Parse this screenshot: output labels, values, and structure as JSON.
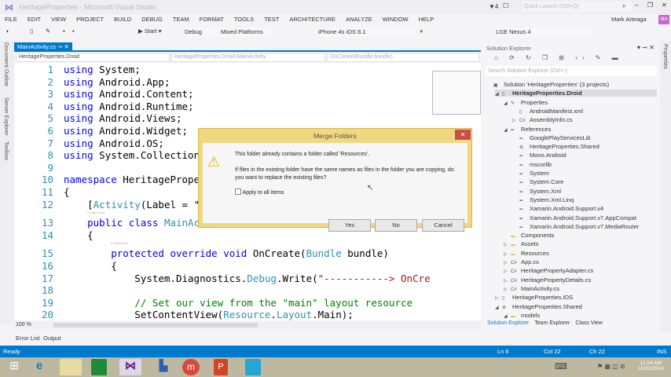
{
  "window": {
    "title": "HeritageProperties - Microsoft Visual Studio",
    "notification_count": "4",
    "quick_launch_placeholder": "Quick Launch (Ctrl+Q)",
    "user": "Mark Arteaga",
    "user_initials": "MA"
  },
  "menu": [
    "FILE",
    "EDIT",
    "VIEW",
    "PROJECT",
    "BUILD",
    "DEBUG",
    "TEAM",
    "FORMAT",
    "TOOLS",
    "TEST",
    "ARCHITECTURE",
    "ANALYZE",
    "WINDOW",
    "HELP"
  ],
  "toolbar": {
    "start": "Start",
    "config": "Debug",
    "platform": "Mixed Platforms",
    "ios_device": "iPhone 4s iOS 8.1",
    "android_device": "LGE Nexus 4"
  },
  "side_tabs": [
    "Document Outline",
    "Server Explorer",
    "Toolbox"
  ],
  "editor": {
    "tab": "MainActivity.cs",
    "nav": [
      "HeritageProperties.Droid",
      "HeritageProperties.Droid.MainActivity",
      "OnCreate(Bundle bundle)"
    ],
    "zoom": "100 %",
    "lines": [
      {
        "n": "1",
        "tokens": [
          {
            "c": "kw",
            "t": "using"
          },
          {
            "t": " System;"
          }
        ]
      },
      {
        "n": "2",
        "tokens": [
          {
            "c": "kw",
            "t": "using"
          },
          {
            "t": " Android.App;"
          }
        ]
      },
      {
        "n": "3",
        "tokens": [
          {
            "c": "kw",
            "t": "using"
          },
          {
            "t": " Android.Content;"
          }
        ]
      },
      {
        "n": "4",
        "tokens": [
          {
            "c": "kw",
            "t": "using"
          },
          {
            "t": " Android.Runtime;"
          }
        ]
      },
      {
        "n": "5",
        "tokens": [
          {
            "c": "kw",
            "t": "using"
          },
          {
            "t": " Android.Views;"
          }
        ]
      },
      {
        "n": "6",
        "tokens": [
          {
            "c": "kw",
            "t": "using"
          },
          {
            "t": " Android.Widget;"
          }
        ]
      },
      {
        "n": "7",
        "tokens": [
          {
            "c": "kw",
            "t": "using"
          },
          {
            "t": " Android.OS;"
          }
        ]
      },
      {
        "n": "8",
        "tokens": [
          {
            "c": "kw",
            "t": "using"
          },
          {
            "t": " System.Collection"
          }
        ]
      },
      {
        "n": "9",
        "tokens": []
      },
      {
        "n": "10",
        "tokens": [
          {
            "c": "kw",
            "t": "namespace"
          },
          {
            "t": " HeritagePrope"
          }
        ]
      },
      {
        "n": "11",
        "tokens": [
          {
            "t": "{"
          }
        ]
      },
      {
        "n": "12",
        "tokens": [
          {
            "t": "    ["
          },
          {
            "c": "ty",
            "t": "Activity"
          },
          {
            "t": "(Label = \""
          }
        ]
      },
      {
        "n": "13",
        "lens": "2 references",
        "tokens": [
          {
            "t": "    "
          },
          {
            "c": "kw",
            "t": "public class"
          },
          {
            "t": " "
          },
          {
            "c": "ty",
            "t": "MainAc"
          }
        ]
      },
      {
        "n": "14",
        "tokens": [
          {
            "t": "    {"
          }
        ]
      },
      {
        "n": "15",
        "lens": "3 references",
        "tokens": [
          {
            "t": "        "
          },
          {
            "c": "kw",
            "t": "protected override void"
          },
          {
            "t": " OnCreate("
          },
          {
            "c": "ty",
            "t": "Bundle"
          },
          {
            "t": " bundle)"
          }
        ]
      },
      {
        "n": "16",
        "tokens": [
          {
            "t": "        {"
          }
        ]
      },
      {
        "n": "17",
        "tokens": [
          {
            "t": "            System.Diagnostics."
          },
          {
            "c": "ty",
            "t": "Debug"
          },
          {
            "t": ".Write("
          },
          {
            "c": "st",
            "t": "\"-----------> OnCre"
          }
        ]
      },
      {
        "n": "18",
        "tokens": []
      },
      {
        "n": "19",
        "tokens": [
          {
            "t": "            "
          },
          {
            "c": "cm",
            "t": "// Set our view from the \"main\" layout resource"
          }
        ]
      },
      {
        "n": "20",
        "tokens": [
          {
            "t": "            SetContentView("
          },
          {
            "c": "ty",
            "t": "Resource"
          },
          {
            "t": "."
          },
          {
            "c": "ty",
            "t": "Layout"
          },
          {
            "t": ".Main);"
          }
        ]
      }
    ]
  },
  "bottom_tabs": [
    "Error List",
    "Output"
  ],
  "status": {
    "text": "Ready",
    "ln": "Ln 6",
    "col": "Col 22",
    "ch": "Ch 22",
    "mode": "INS"
  },
  "clock": {
    "time": "11:54 AM",
    "date": "10/31/2014"
  },
  "solution_explorer": {
    "title": "Solution Explorer",
    "search_placeholder": "Search Solution Explorer (Ctrl+;)",
    "properties_tab": "Properties",
    "items": [
      {
        "label": "Solution 'HeritageProperties' (3 projects)",
        "level": 0,
        "icon": "solution"
      },
      {
        "label": "HeritageProperties.Droid",
        "level": 1,
        "icon": "project",
        "bold": true,
        "expanded": true
      },
      {
        "label": "Properties",
        "level": 2,
        "icon": "wrench",
        "expanded": true
      },
      {
        "label": "AndroidManifest.xml",
        "level": 3,
        "icon": "file"
      },
      {
        "label": "AssemblyInfo.cs",
        "level": 3,
        "icon": "cs",
        "collapsed": true
      },
      {
        "label": "References",
        "level": 2,
        "icon": "ref",
        "expanded": true
      },
      {
        "label": "GooglePlayServicesLib",
        "level": 3,
        "icon": "ref"
      },
      {
        "label": "HeritageProperties.Shared",
        "level": 3,
        "icon": "shared"
      },
      {
        "label": "Mono.Android",
        "level": 3,
        "icon": "ref"
      },
      {
        "label": "mscorlib",
        "level": 3,
        "icon": "ref"
      },
      {
        "label": "System",
        "level": 3,
        "icon": "ref"
      },
      {
        "label": "System.Core",
        "level": 3,
        "icon": "ref"
      },
      {
        "label": "System.Xml",
        "level": 3,
        "icon": "ref"
      },
      {
        "label": "System.Xml.Linq",
        "level": 3,
        "icon": "ref"
      },
      {
        "label": "Xamarin.Android.Support.v4",
        "level": 3,
        "icon": "ref"
      },
      {
        "label": "Xamarin.Android.Support.v7.AppCompat",
        "level": 3,
        "icon": "ref"
      },
      {
        "label": "Xamarin.Android.Support.v7.MediaRouter",
        "level": 3,
        "icon": "ref"
      },
      {
        "label": "Components",
        "level": 2,
        "icon": "folder"
      },
      {
        "label": "Assets",
        "level": 2,
        "icon": "folder",
        "collapsed": true
      },
      {
        "label": "Resources",
        "level": 2,
        "icon": "folder",
        "collapsed": true
      },
      {
        "label": "App.cs",
        "level": 2,
        "icon": "cs",
        "collapsed": true
      },
      {
        "label": "HeritagePropertyAdapter.cs",
        "level": 2,
        "icon": "cs",
        "collapsed": true
      },
      {
        "label": "HeritagePropertyDetails.cs",
        "level": 2,
        "icon": "cs",
        "collapsed": true
      },
      {
        "label": "MainActivity.cs",
        "level": 2,
        "icon": "cs",
        "collapsed": true
      },
      {
        "label": "HeritageProperties.iOS",
        "level": 1,
        "icon": "project",
        "collapsed": true
      },
      {
        "label": "HeritageProperties.Shared",
        "level": 1,
        "icon": "shared",
        "expanded": true
      },
      {
        "label": "models",
        "level": 2,
        "icon": "folder",
        "expanded": true
      }
    ],
    "tabs": [
      "Solution Explorer",
      "Team Explorer",
      "Class View"
    ]
  },
  "dialog": {
    "title": "Merge Folders",
    "message1": "This folder already contains a folder called 'Resources'.",
    "message2": "If files in the existing folder have the same names as files in the folder you are copying, do you want to replace the existing files?",
    "checkbox": "Apply to all items",
    "yes": "Yes",
    "no": "No",
    "cancel": "Cancel",
    "close": "✕"
  },
  "colors": {
    "accent": "#007acc",
    "dialog_frame": "#f0d880",
    "close_red": "#c7504a"
  }
}
